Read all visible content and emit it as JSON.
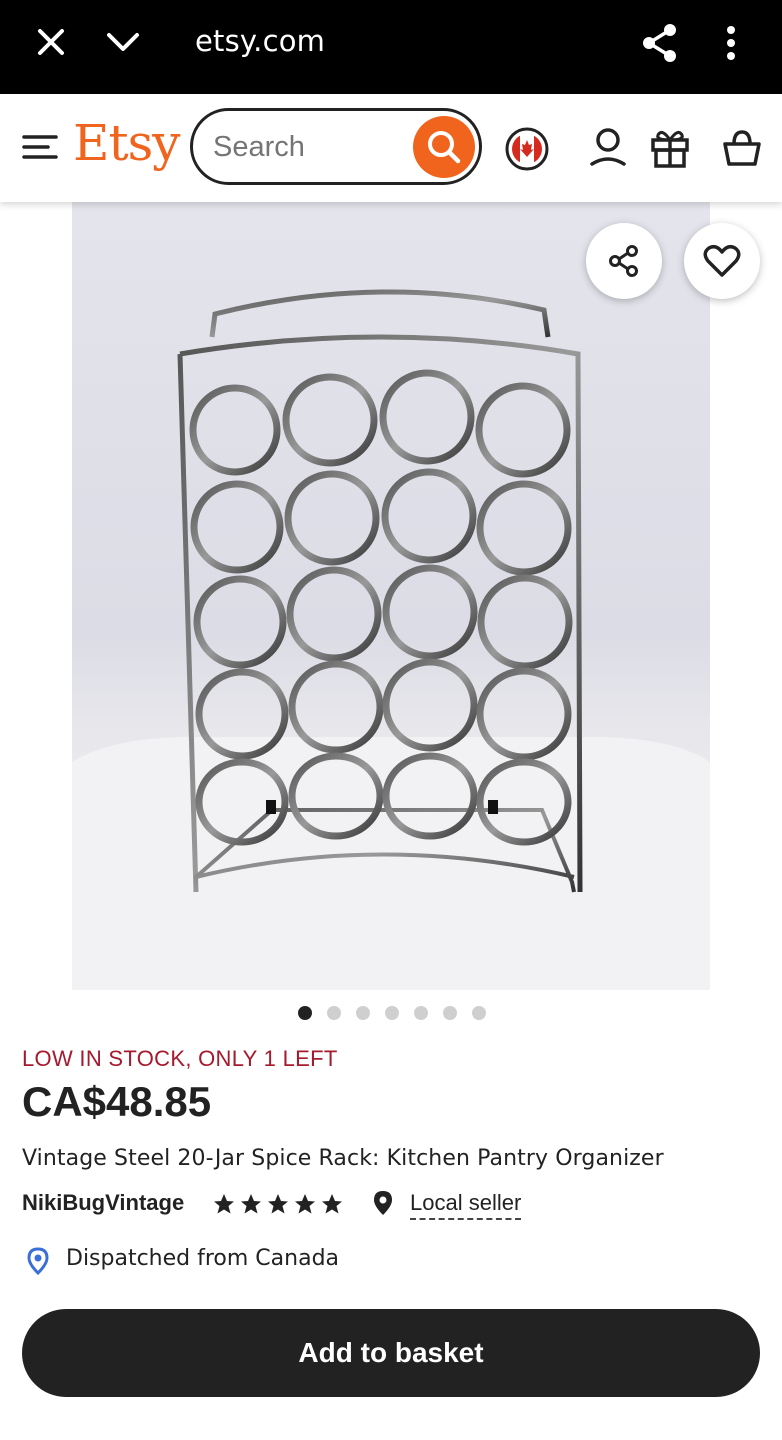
{
  "browser": {
    "url": "etsy.com"
  },
  "header": {
    "logo": "Etsy",
    "search_placeholder": "Search"
  },
  "gallery": {
    "total_images": 7,
    "active_index": 0
  },
  "product": {
    "stock_notice": "LOW IN STOCK, ONLY 1 LEFT",
    "price": "CA$48.85",
    "title": "Vintage Steel 20-Jar Spice Rack: Kitchen Pantry Organizer",
    "shop_name": "NikiBugVintage",
    "rating_stars": 5,
    "local_seller_label": "Local seller",
    "dispatch_text": "Dispatched from Canada"
  },
  "actions": {
    "add_to_basket": "Add to basket"
  },
  "colors": {
    "brand_orange": "#f1641e",
    "stock_red": "#a61a2e",
    "button_dark": "#222222",
    "location_blue": "#3b6fd8"
  }
}
